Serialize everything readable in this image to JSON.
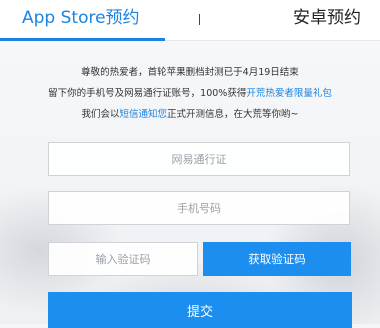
{
  "tabs": {
    "app_store": "App Store预约",
    "android": "安卓预约"
  },
  "notice": {
    "line1": "尊敬的热爱者，首轮苹果删档封测已于4月19日结束",
    "line2_pre": "留下你的手机号及网易通行证账号，100%获得",
    "line2_link": "开荒热爱者限量礼包",
    "line3_pre": "我们会以",
    "line3_link": "短信通知您",
    "line3_post": "正式开测信息，在大荒等你哟~"
  },
  "form": {
    "account_placeholder": "网易通行证",
    "phone_placeholder": "手机号码",
    "code_placeholder": "输入验证码",
    "get_code_label": "获取验证码",
    "submit_label": "提交"
  },
  "colors": {
    "accent": "#1a84e0",
    "button": "#1c8ef0"
  }
}
